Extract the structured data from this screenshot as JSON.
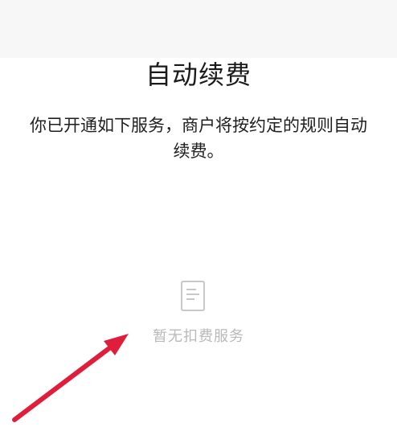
{
  "header": {
    "title": "自动续费"
  },
  "main": {
    "description": "你已开通如下服务，商户将按约定的规则自动续费。",
    "empty_state": {
      "icon": "document-icon",
      "text": "暂无扣费服务"
    }
  },
  "colors": {
    "arrow": "#e01e3c",
    "empty_text": "#b9b9b9",
    "icon": "#c8c8c8"
  }
}
